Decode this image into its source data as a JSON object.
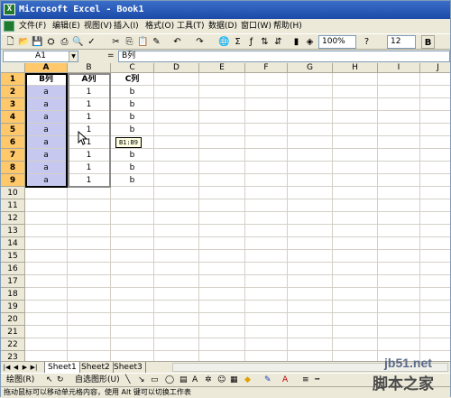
{
  "window": {
    "title": "Microsoft Excel - Book1",
    "app_icon": "excel-icon"
  },
  "menu": [
    "文件(F)",
    "编辑(E)",
    "视图(V)",
    "插入(I)",
    "格式(O)",
    "工具(T)",
    "数据(D)",
    "窗口(W)",
    "帮助(H)"
  ],
  "toolbar": {
    "zoom": "100%",
    "font_size": "12",
    "bold_label": "B"
  },
  "formula_bar": {
    "name_box": "A1",
    "equals": "=",
    "content": "B列"
  },
  "grid": {
    "columns": [
      "A",
      "B",
      "C",
      "D",
      "E",
      "F",
      "G",
      "H",
      "I",
      "J"
    ],
    "rows": [
      "1",
      "2",
      "3",
      "4",
      "5",
      "6",
      "7",
      "8",
      "9",
      "10",
      "11",
      "12",
      "13",
      "14",
      "15",
      "16",
      "17",
      "18",
      "19",
      "20",
      "21",
      "22",
      "23"
    ],
    "cells": [
      [
        "B列",
        "A列",
        "C列"
      ],
      [
        "a",
        "1",
        "b"
      ],
      [
        "a",
        "1",
        "b"
      ],
      [
        "a",
        "1",
        "b"
      ],
      [
        "a",
        "1",
        "b"
      ],
      [
        "a",
        "1",
        "b"
      ],
      [
        "a",
        "1",
        "b"
      ],
      [
        "a",
        "1",
        "b"
      ],
      [
        "a",
        "1",
        "b"
      ]
    ],
    "drag_tooltip": "B1:B9"
  },
  "sheet_tabs": [
    "Sheet1",
    "Sheet2",
    "Sheet3"
  ],
  "drawing_toolbar": {
    "draw_label": "绘图(R)",
    "autoshapes_label": "自选图形(U)"
  },
  "status": "拖动鼠标可以移动单元格内容，使用 Alt 键可以切换工作表",
  "watermark": {
    "line1": "jb51.net",
    "line2": "脚本之家"
  }
}
